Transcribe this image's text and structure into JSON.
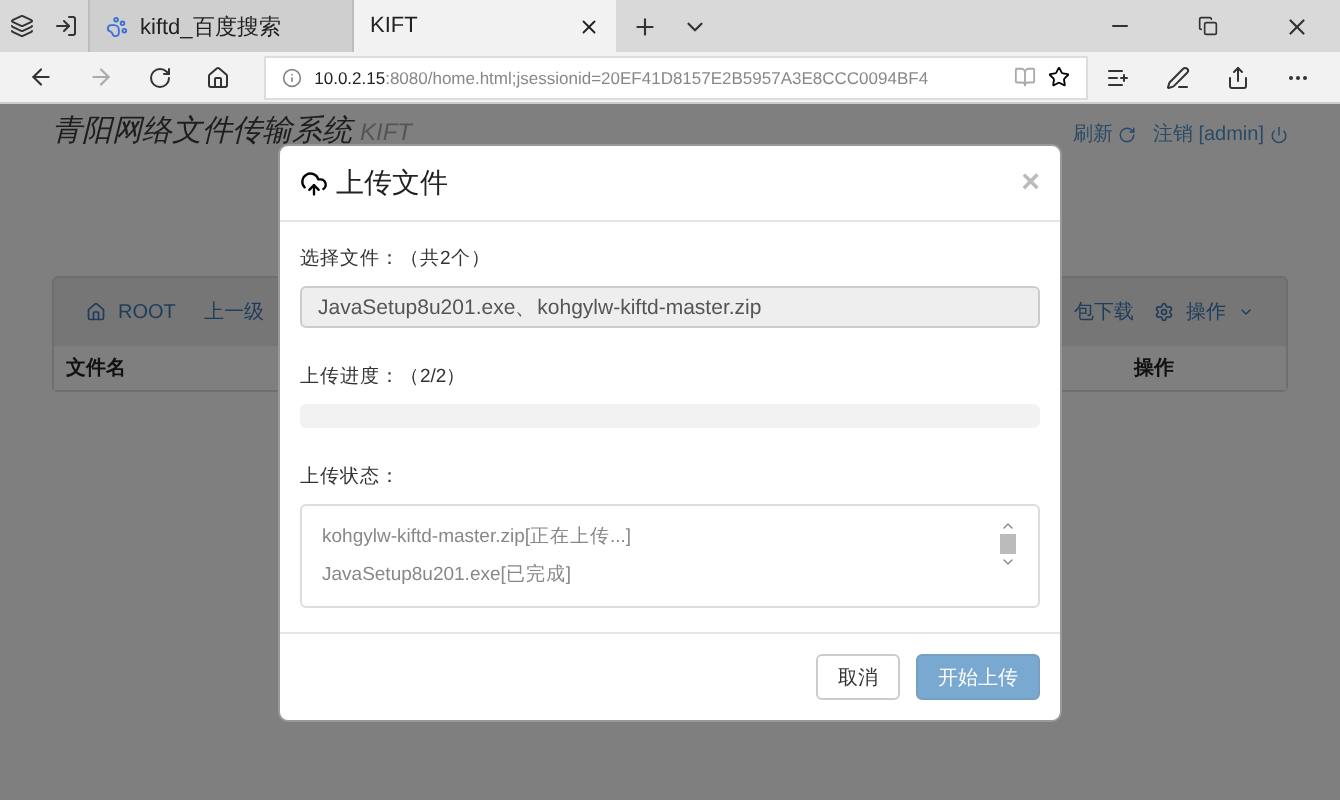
{
  "browser": {
    "tabs": [
      {
        "title": "kiftd_百度搜索",
        "selected": false
      },
      {
        "title": "KIFT",
        "selected": true
      }
    ],
    "url": {
      "host": "10.0.2.15",
      "rest": ":8080/home.html;jsessionid=20EF41D8157E2B5957A3E8CCC0094BF4"
    }
  },
  "page": {
    "title": "青阳网络文件传输系统",
    "subtitle": "KIFT",
    "refresh": "刷新",
    "logout": "注销 [admin]",
    "toolbar": {
      "root": "ROOT",
      "up": "上一级",
      "pack": "包下载",
      "ops": "操作"
    },
    "columns": [
      "文件名",
      "操作"
    ]
  },
  "dialog": {
    "title": "上传文件",
    "close": "×",
    "file_label": "选择文件：（共2个）",
    "files": "JavaSetup8u201.exe、kohgylw-kiftd-master.zip",
    "progress_label": "上传进度：（2/2）",
    "progress": {
      "level": 0
    },
    "status_label": "上传状态：",
    "status_lines": [
      "kohgylw-kiftd-master.zip[正在上传...]",
      "JavaSetup8u201.exe[已完成]"
    ],
    "buttons": [
      {
        "label": "取消",
        "kind": "default",
        "disabled": false
      },
      {
        "label": "开始上传",
        "kind": "primary",
        "disabled": true
      }
    ]
  }
}
